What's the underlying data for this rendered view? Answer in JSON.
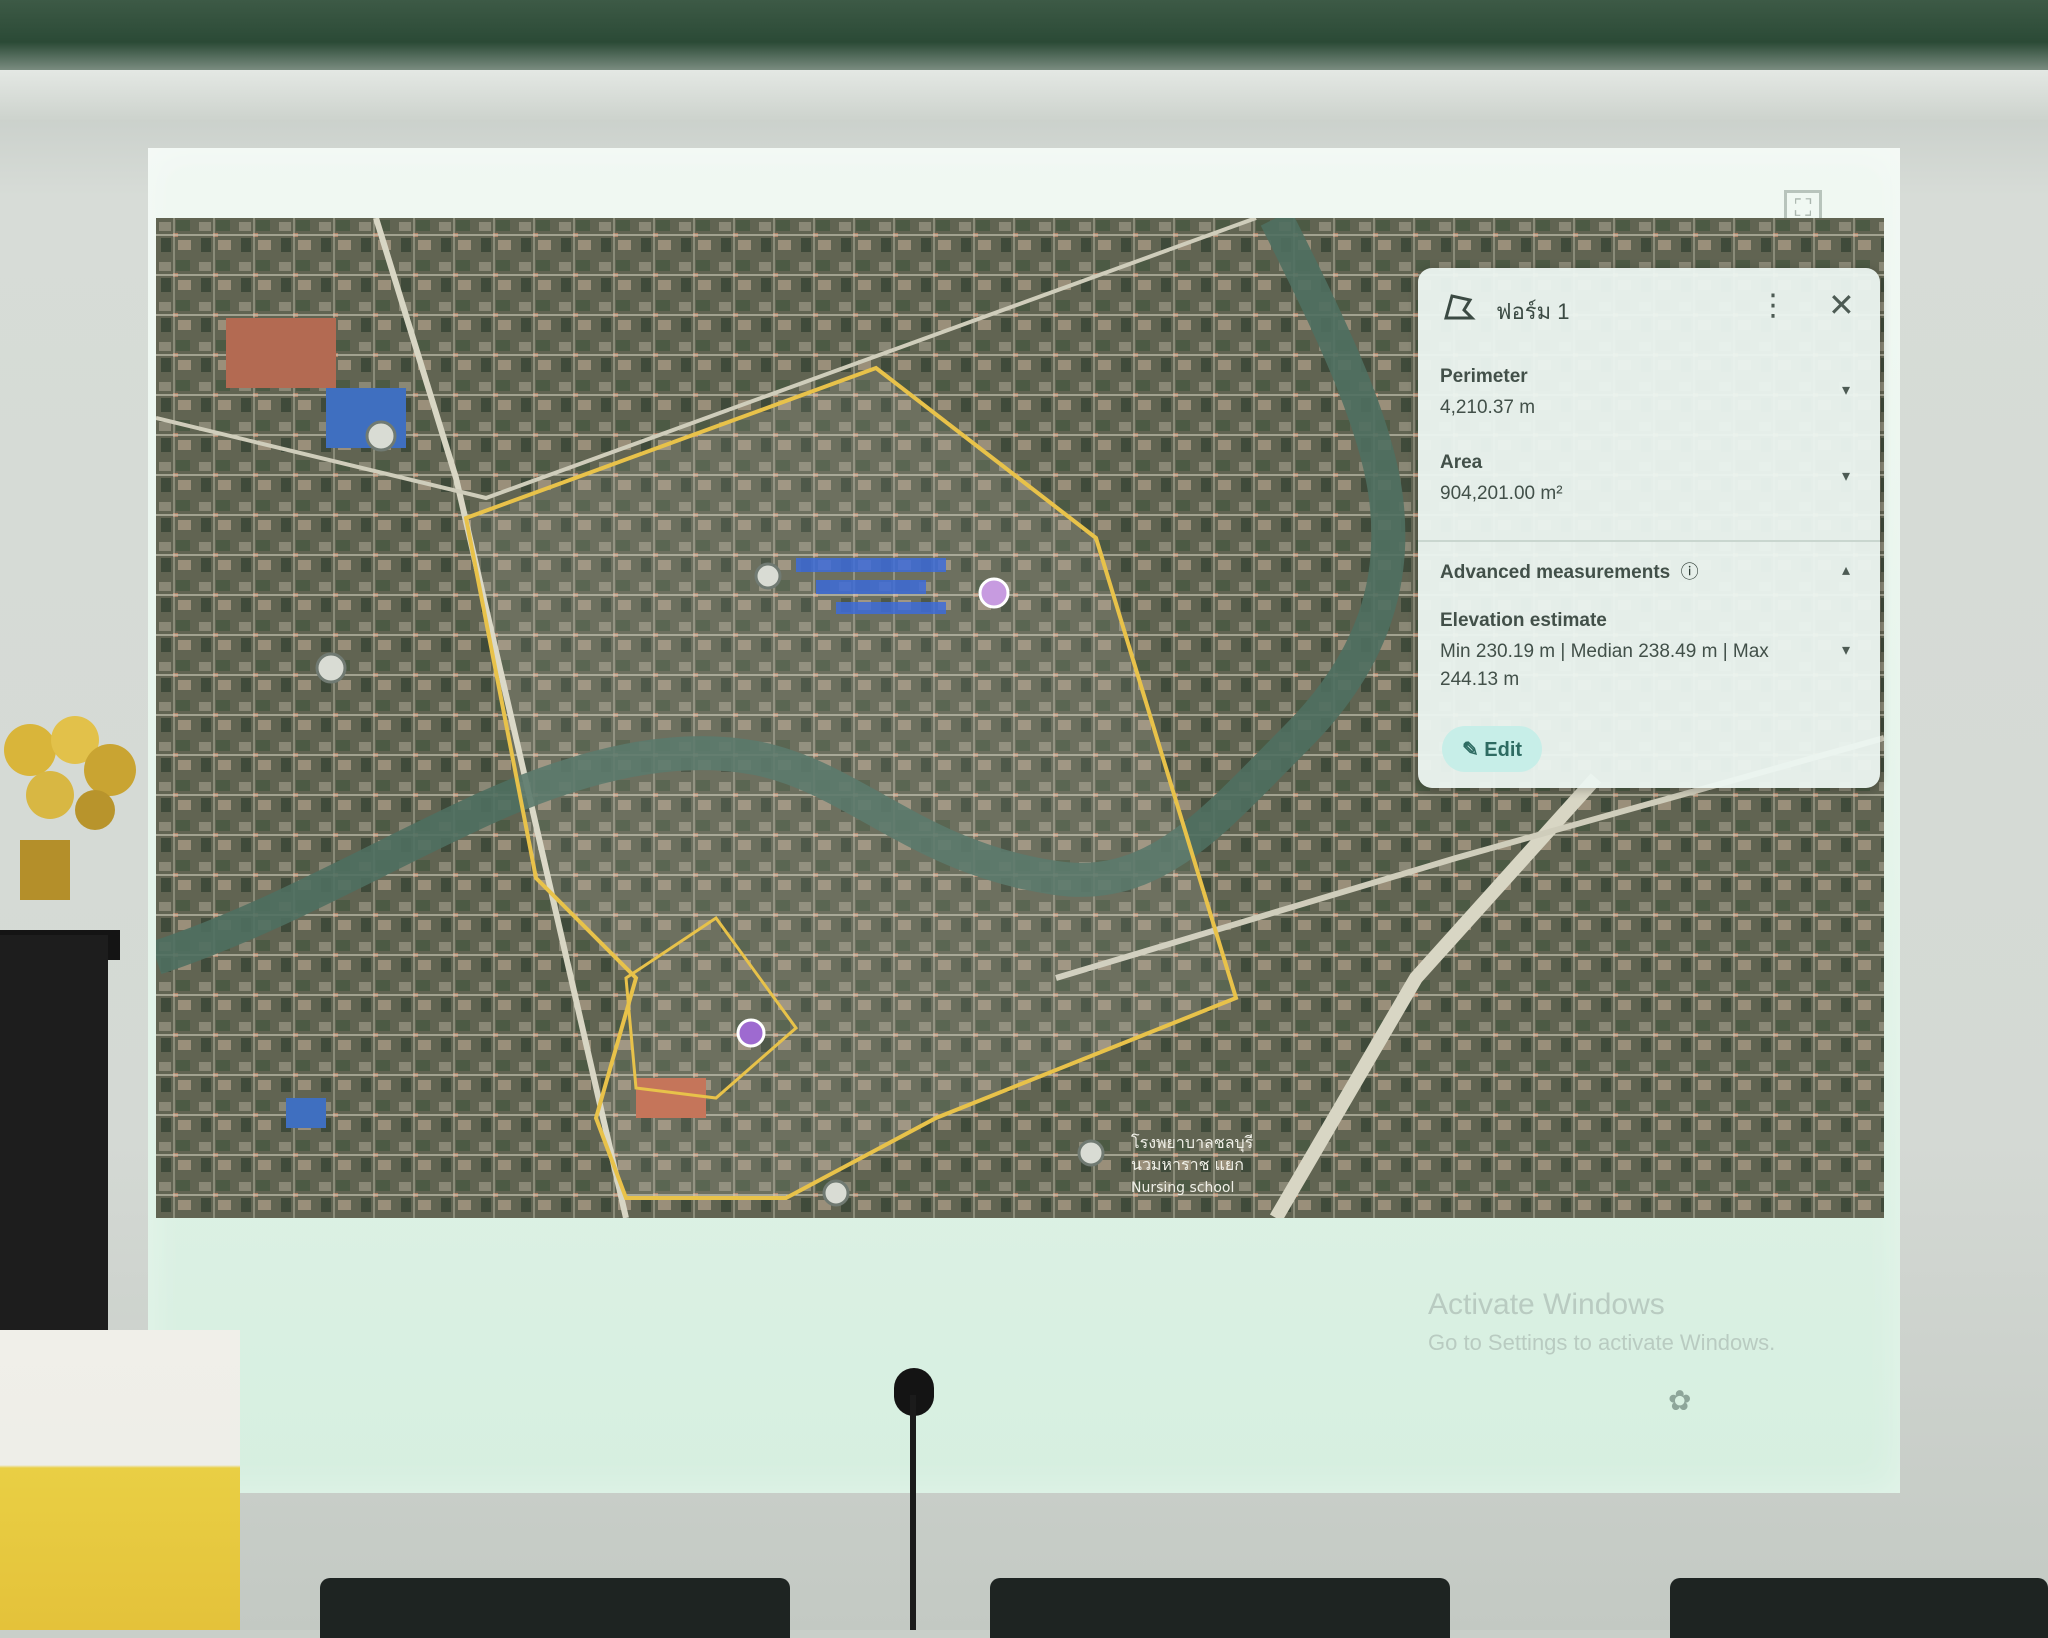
{
  "panel": {
    "title": "ฟอร์ม 1",
    "perimeter": {
      "label": "Perimeter",
      "value": "4,210.37 m"
    },
    "area": {
      "label": "Area",
      "value": "904,201.00 m²"
    },
    "advanced": {
      "label": "Advanced measurements",
      "info_icon": "ⓘ"
    },
    "elevation": {
      "label": "Elevation estimate",
      "value": "Min 230.19 m | Median 238.49 m | Max 244.13 m"
    },
    "edit_label": "Edit"
  },
  "map_labels": {
    "bottom_line1": "โรงพยาบาลชลบุรี",
    "bottom_line2": "นวมหาราช แยก",
    "bottom_line3": "Nursing school"
  },
  "windows": {
    "activate_title": "Activate Windows",
    "activate_sub": "Go to Settings to activate Windows."
  },
  "icons": {
    "panel_icon": "polygon-icon",
    "more": "⋮",
    "close": "✕",
    "chevron_down": "▾",
    "chevron_up": "▴",
    "pencil": "✎",
    "expand": "⛶",
    "pegman": "♟",
    "compass": "◎",
    "layers": "▭",
    "north": "▲",
    "zoom_out": "−",
    "zoom_in": "+",
    "tray": "✿"
  },
  "colors": {
    "boundary": "#e8c24a",
    "river": "#4f6f60",
    "map_base": "#5d6151"
  }
}
